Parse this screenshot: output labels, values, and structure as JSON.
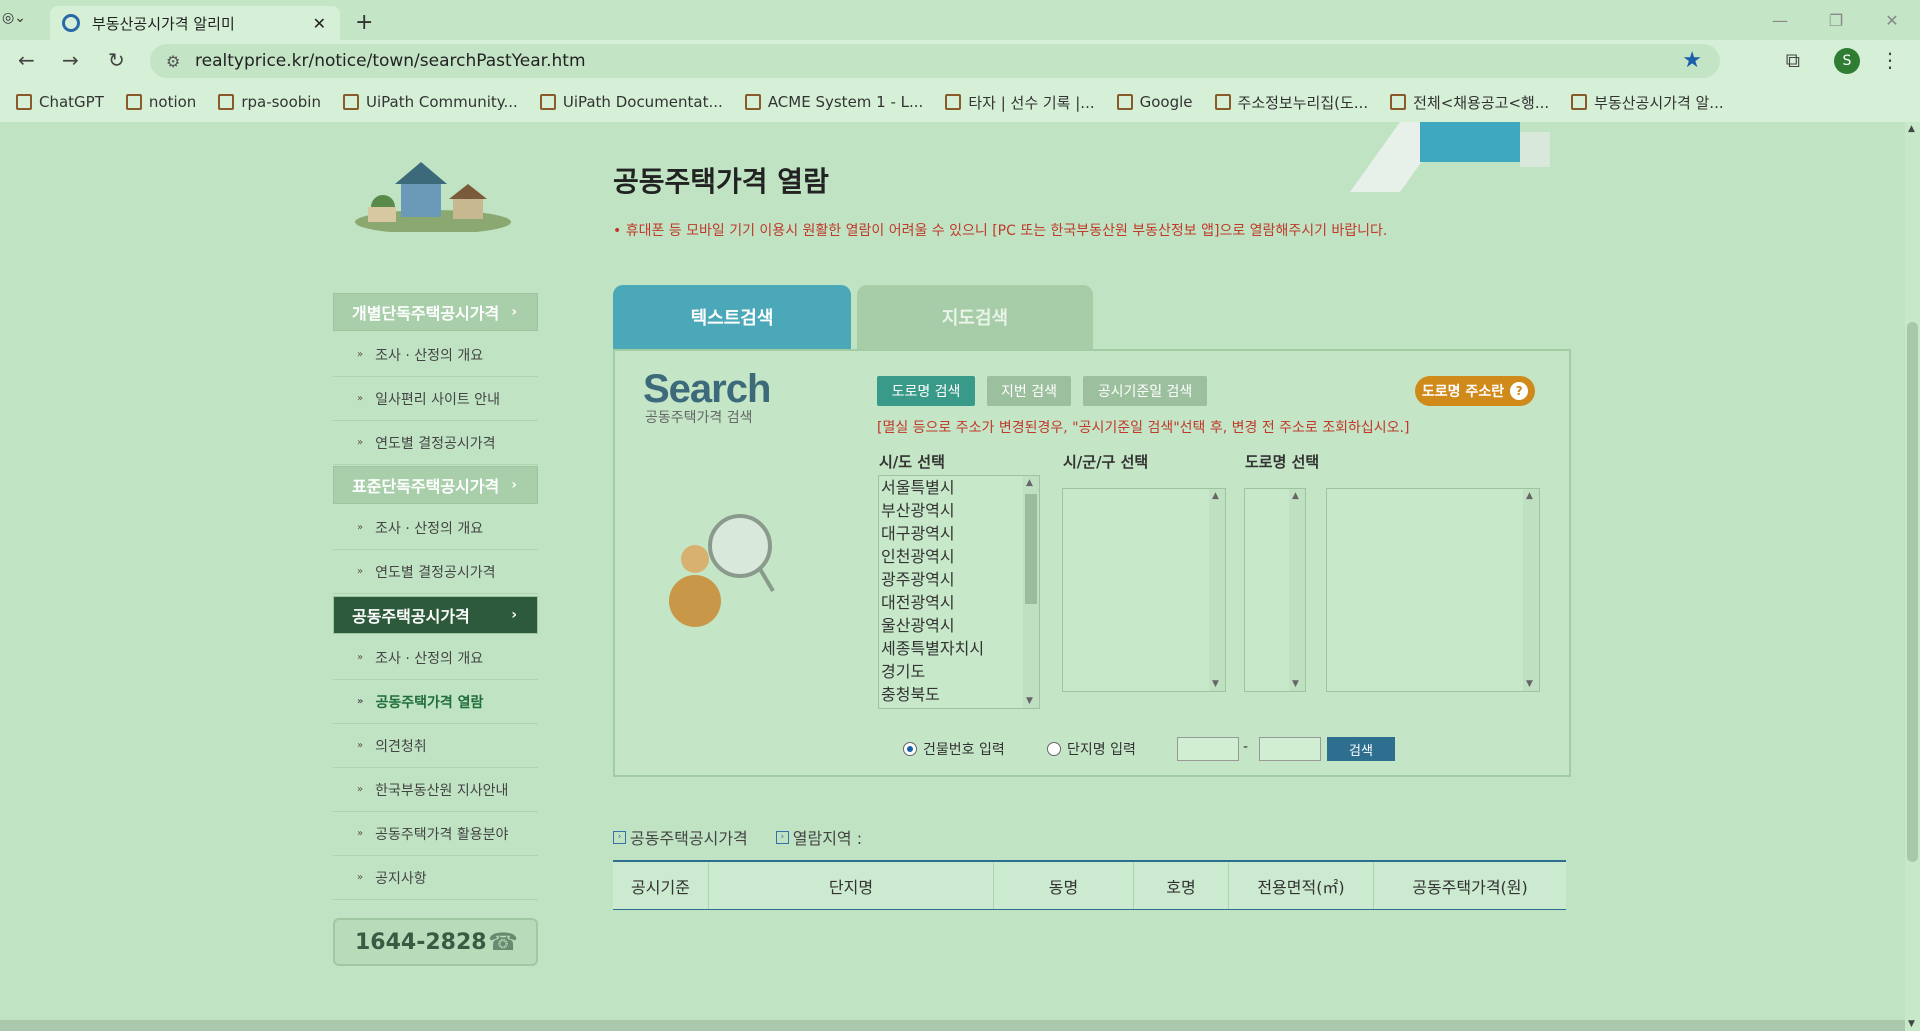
{
  "browser": {
    "tab_title": "부동산공시가격 알리미",
    "url": "realtyprice.kr/notice/town/searchPastYear.htm",
    "avatar_letter": "S",
    "bookmarks": [
      {
        "label": "ChatGPT",
        "icon": "chatgpt-icon"
      },
      {
        "label": "notion",
        "icon": "notion-icon"
      },
      {
        "label": "rpa-soobin",
        "icon": "github-icon"
      },
      {
        "label": "UiPath Community...",
        "icon": "uipath-icon"
      },
      {
        "label": "UiPath Documentat...",
        "icon": "uipath-icon"
      },
      {
        "label": "ACME System 1 - L...",
        "icon": "uipath-icon"
      },
      {
        "label": "타자 | 선수 기록 |...",
        "icon": "baseball-icon"
      },
      {
        "label": "Google",
        "icon": "google-icon"
      },
      {
        "label": "주소정보누리집(도...",
        "icon": "home-icon"
      },
      {
        "label": "전체<채용공고<행...",
        "icon": "bird-icon"
      },
      {
        "label": "부동산공시가격 알...",
        "icon": "realty-icon"
      }
    ]
  },
  "sidebar": {
    "groups": [
      {
        "label": "개별단독주택공시가격",
        "items": [
          "조사 · 산정의 개요",
          "일사편리 사이트 안내",
          "연도별 결정공시가격"
        ]
      },
      {
        "label": "표준단독주택공시가격",
        "items": [
          "조사 · 산정의 개요",
          "연도별 결정공시가격"
        ]
      },
      {
        "label": "공동주택공시가격",
        "items": [
          "조사 · 산정의 개요",
          "공동주택가격 열람",
          "의견청취",
          "한국부동산원 지사안내",
          "공동주택가격 활용분야",
          "공지사항"
        ]
      }
    ],
    "phone": "1644-2828"
  },
  "main": {
    "title": "공동주택가격 열람",
    "notice": "• 휴대폰 등 모바일 기기 이용시 원활한 열람이 어려울 수 있으니 [PC 또는 한국부동산원 부동산정보 앱]으로 열람해주시기 바랍니다.",
    "tabs": [
      "텍스트검색",
      "지도검색"
    ],
    "search_logo": "Search",
    "search_sub": "공동주택가격 검색",
    "buttons": {
      "road": "도로명 검색",
      "lot": "지번 검색",
      "date": "공시기준일 검색",
      "guide": "도로명 주소란",
      "search": "검색"
    },
    "warning": "[멸실 등으로 주소가 변경된경우, \"공시기준일 검색\"선택 후, 변경 전 주소로 조회하십시오.]",
    "labels": {
      "sido": "시/도 선택",
      "sigungu": "시/군/구 선택",
      "road": "도로명 선택"
    },
    "sido_options": [
      "서울특별시",
      "부산광역시",
      "대구광역시",
      "인천광역시",
      "광주광역시",
      "대전광역시",
      "울산광역시",
      "세종특별자치시",
      "경기도",
      "충청북도"
    ],
    "radio": {
      "building": "건물번호 입력",
      "complex": "단지명 입력"
    },
    "legend": {
      "price": "공동주택공시가격",
      "region": "열람지역 :"
    },
    "table_headers": [
      "공시기준",
      "단지명",
      "동명",
      "호명",
      "전용면적(㎡)",
      "공동주택가격(원)"
    ]
  }
}
